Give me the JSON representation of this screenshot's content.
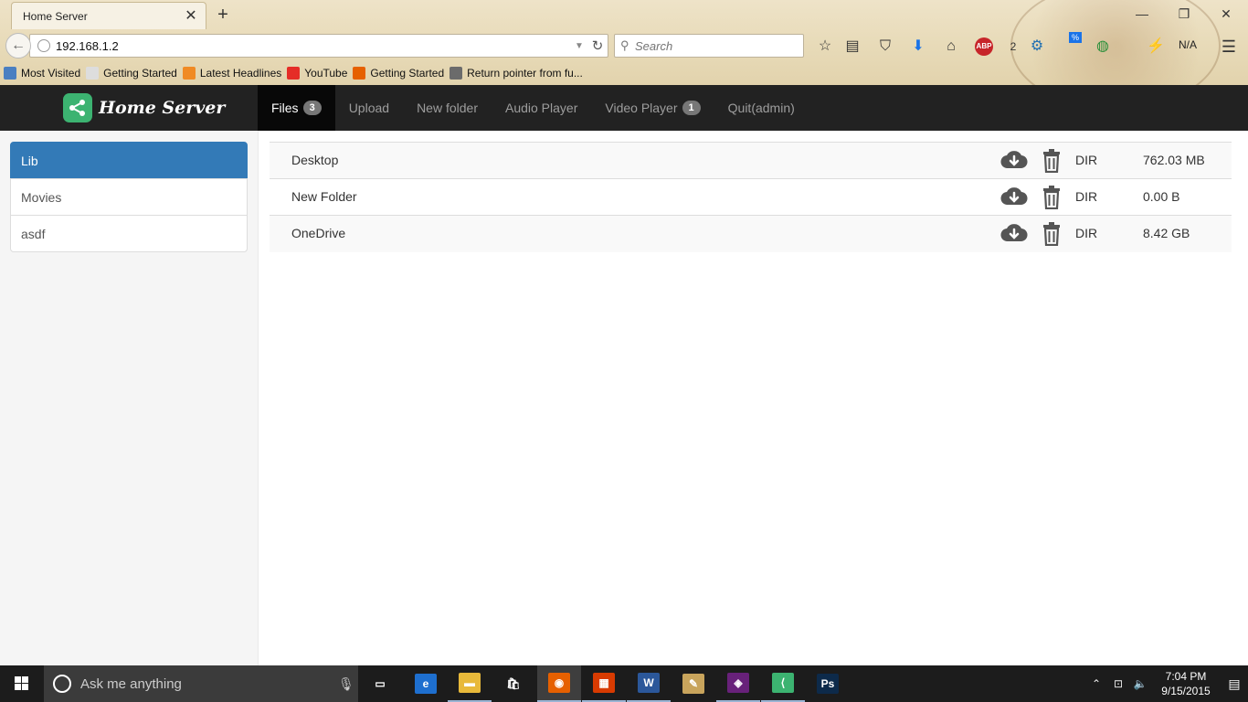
{
  "browser": {
    "tab_title": "Home Server",
    "tab_close": "✕",
    "new_tab": "+",
    "url": "192.168.1.2",
    "search_placeholder": "Search",
    "addon_badge": "2",
    "addon_status": "N/A",
    "addon_pct": "%",
    "abp_label": "ABP",
    "window_controls": {
      "minimize": "—",
      "maximize": "❐",
      "close": "✕"
    },
    "bookmarks": [
      {
        "label": "Most Visited",
        "icon": "most-visited-icon",
        "color": "#4a7fc1"
      },
      {
        "label": "Getting Started",
        "icon": "page-icon",
        "color": "#dddddd"
      },
      {
        "label": "Latest Headlines",
        "icon": "rss-icon",
        "color": "#f08a24"
      },
      {
        "label": "YouTube",
        "icon": "youtube-icon",
        "color": "#e52d27"
      },
      {
        "label": "Getting Started",
        "icon": "firefox-icon",
        "color": "#e66000"
      },
      {
        "label": "Return pointer from fu...",
        "icon": "diamond-icon",
        "color": "#6b6b6b"
      }
    ]
  },
  "app": {
    "brand": "Home Server",
    "brand_color": "#3cb371",
    "nav": [
      {
        "label": "Files",
        "badge": "3",
        "active": true
      },
      {
        "label": "Upload"
      },
      {
        "label": "New folder"
      },
      {
        "label": "Audio Player"
      },
      {
        "label": "Video Player",
        "badge": "1"
      },
      {
        "label": "Quit(admin)"
      }
    ],
    "sidebar": [
      {
        "label": "Lib",
        "active": true
      },
      {
        "label": "Movies"
      },
      {
        "label": "asdf"
      }
    ],
    "files": [
      {
        "name": "Desktop",
        "type": "DIR",
        "size": "762.03 MB"
      },
      {
        "name": "New Folder",
        "type": "DIR",
        "size": "0.00 B"
      },
      {
        "name": "OneDrive",
        "type": "DIR",
        "size": "8.42 GB"
      }
    ],
    "accent_color": "#337ab7"
  },
  "taskbar": {
    "search_placeholder": "Ask me anything",
    "time": "7:04 PM",
    "date": "9/15/2015",
    "apps": [
      {
        "name": "task-view",
        "glyph": "▭",
        "color": "transparent"
      },
      {
        "name": "edge",
        "glyph": "e",
        "color": "#1e6fcf"
      },
      {
        "name": "file-explorer",
        "glyph": "▬",
        "color": "#e8b93a"
      },
      {
        "name": "store",
        "glyph": "🛍",
        "color": "transparent"
      },
      {
        "name": "firefox",
        "glyph": "◉",
        "color": "#e66000"
      },
      {
        "name": "office",
        "glyph": "▦",
        "color": "#d83b01"
      },
      {
        "name": "word",
        "glyph": "W",
        "color": "#2b579a"
      },
      {
        "name": "paint",
        "glyph": "✎",
        "color": "#c8a45c"
      },
      {
        "name": "visual-studio",
        "glyph": "◈",
        "color": "#68217a"
      },
      {
        "name": "home-server",
        "glyph": "⟨",
        "color": "#3cb371"
      },
      {
        "name": "photoshop",
        "glyph": "Ps",
        "color": "#0d2a4a"
      }
    ]
  }
}
